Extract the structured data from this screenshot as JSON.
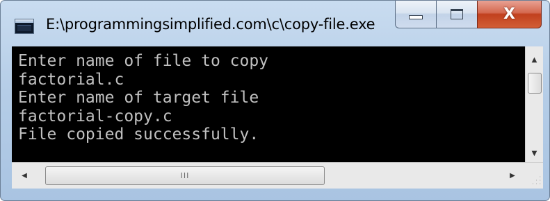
{
  "window": {
    "title": "E:\\programmingsimplified.com\\c\\copy-file.exe"
  },
  "caption_buttons": {
    "close_glyph": "X"
  },
  "console": {
    "lines": [
      "Enter name of file to copy",
      "factorial.c",
      "Enter name of target file",
      "factorial-copy.c",
      "File copied successfully."
    ]
  },
  "scrollbars": {
    "up_arrow": "▲",
    "down_arrow": "▼",
    "left_arrow": "◀",
    "right_arrow": "▶",
    "h_grip": "III"
  },
  "colors": {
    "console_background": "#000000",
    "console_text": "#c0c0c0",
    "close_button": "#c1401e",
    "window_frame": "#b5cde7"
  },
  "icons": {
    "app_icon": "console-window-icon",
    "minimize": "minimize-icon",
    "maximize": "maximize-icon",
    "close": "close-icon"
  }
}
